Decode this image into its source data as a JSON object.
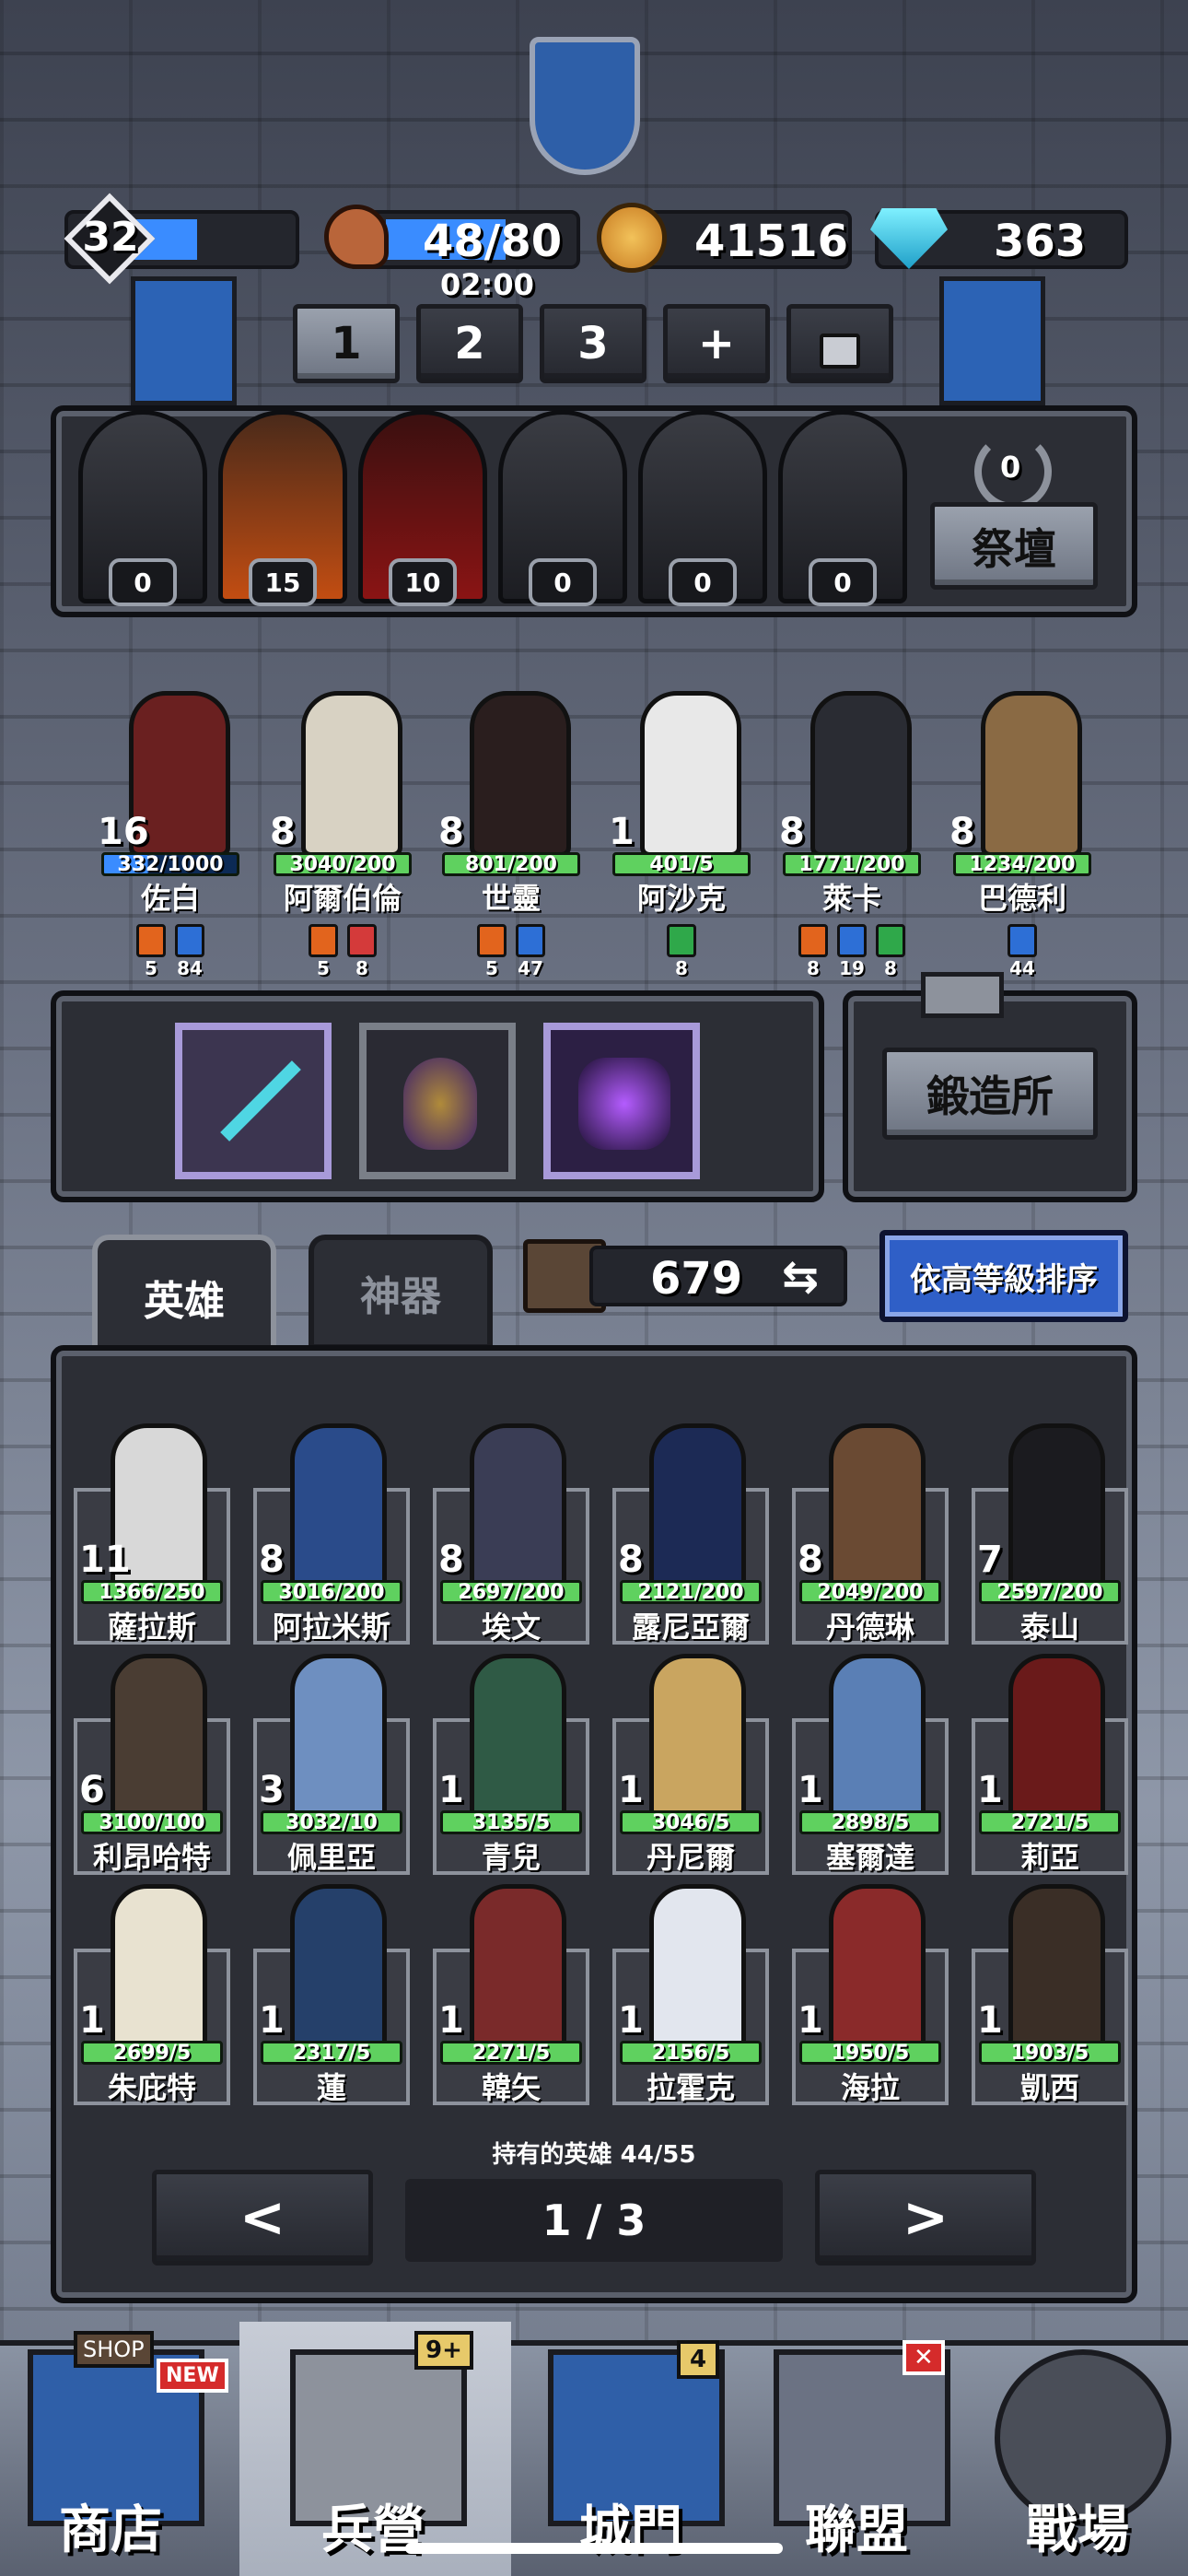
{
  "top": {
    "player_level": "32",
    "stamina": "48/80",
    "timer": "02:00",
    "gold": "41516",
    "gems": "363"
  },
  "team_tabs": [
    "1",
    "2",
    "3",
    "+"
  ],
  "altar": {
    "counts": [
      "0",
      "15",
      "10",
      "0",
      "0",
      "0"
    ],
    "altar_count": "0",
    "altar_label": "祭壇"
  },
  "team_heroes": [
    {
      "name": "佐白",
      "level": "16",
      "exp": "332/1000",
      "badges": [
        {
          "color": "#e2641d",
          "n": "5"
        },
        {
          "color": "#2d6fd6",
          "n": "84"
        }
      ]
    },
    {
      "name": "阿爾伯倫",
      "level": "8",
      "exp": "3040/200",
      "badges": [
        {
          "color": "#e2641d",
          "n": "5"
        },
        {
          "color": "#d43a3a",
          "n": "8"
        }
      ]
    },
    {
      "name": "世靈",
      "level": "8",
      "exp": "801/200",
      "badges": [
        {
          "color": "#e2641d",
          "n": "5"
        },
        {
          "color": "#2d6fd6",
          "n": "47"
        }
      ]
    },
    {
      "name": "阿沙克",
      "level": "1",
      "exp": "401/5",
      "badges": [
        {
          "color": "#2fa84a",
          "n": "8"
        }
      ]
    },
    {
      "name": "萊卡",
      "level": "8",
      "exp": "1771/200",
      "badges": [
        {
          "color": "#e2641d",
          "n": "8"
        },
        {
          "color": "#2d6fd6",
          "n": "19"
        },
        {
          "color": "#2fa84a",
          "n": "8"
        }
      ]
    },
    {
      "name": "巴德利",
      "level": "8",
      "exp": "1234/200",
      "badges": [
        {
          "color": "#2d6fd6",
          "n": "44"
        }
      ]
    }
  ],
  "forge_label": "鍛造所",
  "tabs": {
    "heroes": "英雄",
    "artifacts": "神器"
  },
  "book_count": "679",
  "sort_label": "依高等級排序",
  "hero_grid": [
    {
      "name": "薩拉斯",
      "level": "11",
      "exp": "1366/250"
    },
    {
      "name": "阿拉米斯",
      "level": "8",
      "exp": "3016/200"
    },
    {
      "name": "埃文",
      "level": "8",
      "exp": "2697/200"
    },
    {
      "name": "露尼亞爾",
      "level": "8",
      "exp": "2121/200"
    },
    {
      "name": "丹德琳",
      "level": "8",
      "exp": "2049/200"
    },
    {
      "name": "泰山",
      "level": "7",
      "exp": "2597/200"
    },
    {
      "name": "利昂哈特",
      "level": "6",
      "exp": "3100/100"
    },
    {
      "name": "佩里亞",
      "level": "3",
      "exp": "3032/10"
    },
    {
      "name": "青兒",
      "level": "1",
      "exp": "3135/5"
    },
    {
      "name": "丹尼爾",
      "level": "1",
      "exp": "3046/5"
    },
    {
      "name": "塞爾達",
      "level": "1",
      "exp": "2898/5"
    },
    {
      "name": "莉亞",
      "level": "1",
      "exp": "2721/5"
    },
    {
      "name": "朱庇特",
      "level": "1",
      "exp": "2699/5"
    },
    {
      "name": "蓮",
      "level": "1",
      "exp": "2317/5"
    },
    {
      "name": "韓矢",
      "level": "1",
      "exp": "2271/5"
    },
    {
      "name": "拉霍克",
      "level": "1",
      "exp": "2156/5"
    },
    {
      "name": "海拉",
      "level": "1",
      "exp": "1950/5"
    },
    {
      "name": "凱西",
      "level": "1",
      "exp": "1903/5"
    }
  ],
  "owned": {
    "label": "持有的英雄",
    "value": "44/55"
  },
  "pager": {
    "prev": "<",
    "page": "1 / 3",
    "next": ">"
  },
  "nav": [
    {
      "label": "商店",
      "badge": "NEW",
      "tag": "SHOP"
    },
    {
      "label": "兵營",
      "badge": "9+"
    },
    {
      "label": "城門",
      "badge": "4"
    },
    {
      "label": "聯盟",
      "badge": "✕"
    },
    {
      "label": "戰場",
      "badge": ""
    }
  ],
  "colors": {
    "accent": "#3a8cff",
    "exp_bar": "#5fd15f",
    "gold": "#e7a73a",
    "gem": "#3ad4f0"
  }
}
